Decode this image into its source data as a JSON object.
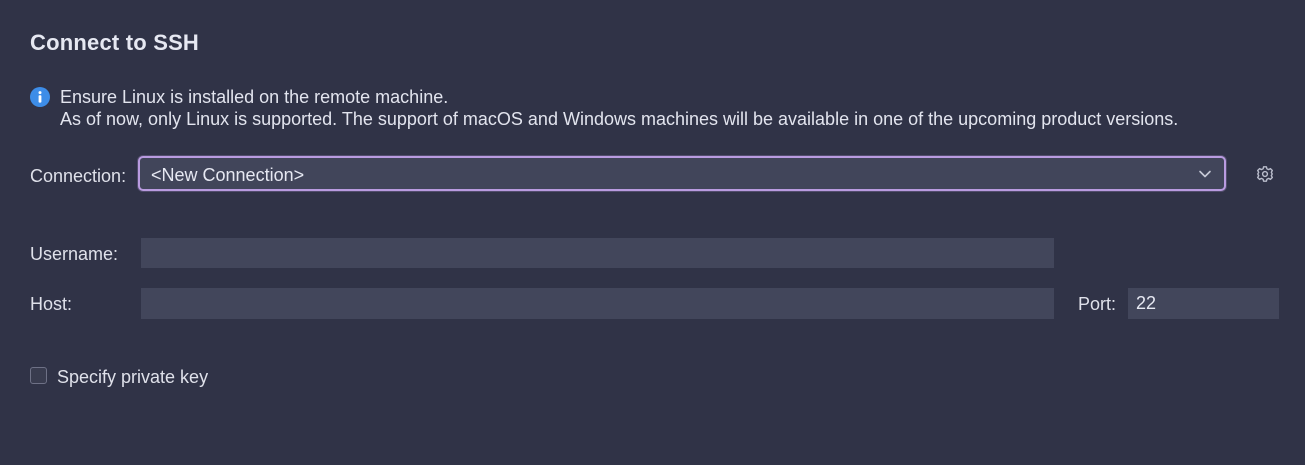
{
  "dialog": {
    "title": "Connect to SSH",
    "info_icon": "info-circle-icon",
    "info_line1": "Ensure Linux is installed on the remote machine.",
    "info_line2": "As of now, only Linux is supported. The support of macOS and Windows machines will be available in one of the upcoming product versions."
  },
  "connection": {
    "label": "Connection:",
    "selected": "<New Connection>",
    "chevron_icon": "chevron-down-icon",
    "settings_icon": "gear-icon"
  },
  "username": {
    "label": "Username:",
    "value": ""
  },
  "host": {
    "label": "Host:",
    "value": ""
  },
  "port": {
    "label": "Port:",
    "value": "22"
  },
  "private_key": {
    "label": "Specify private key",
    "checked": false
  },
  "colors": {
    "background": "#303347",
    "field_background": "#42465b",
    "focus_border": "#b99be0",
    "info_blue": "#3d8de8"
  }
}
